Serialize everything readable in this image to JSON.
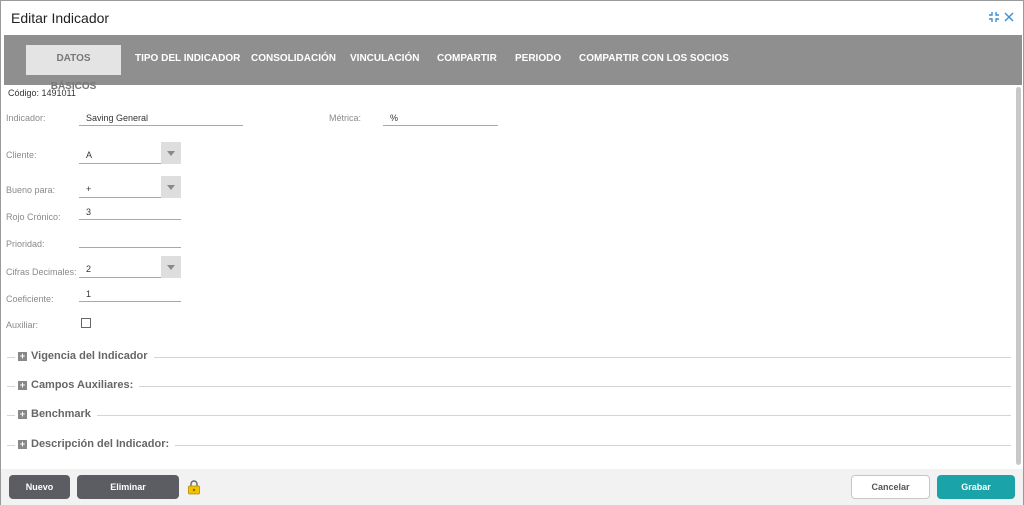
{
  "window": {
    "title": "Editar Indicador",
    "icons": [
      "collapse-icon",
      "close-icon"
    ]
  },
  "tabs": [
    {
      "label": "DATOS BÁSICOS",
      "active": true
    },
    {
      "label": "TIPO DEL INDICADOR",
      "active": false
    },
    {
      "label": "CONSOLIDACIÓN",
      "active": false
    },
    {
      "label": "VINCULACIÓN",
      "active": false
    },
    {
      "label": "COMPARTIR",
      "active": false
    },
    {
      "label": "PERIODO",
      "active": false
    },
    {
      "label": "COMPARTIR CON LOS SOCIOS",
      "active": false
    }
  ],
  "form": {
    "code": "Código: 1491011",
    "indicador": {
      "label": "Indicador:",
      "value": "Saving General"
    },
    "metrica": {
      "label": "Métrica:",
      "value": "%"
    },
    "cliente": {
      "label": "Cliente:",
      "value": "A"
    },
    "bueno_para": {
      "label": "Bueno para:",
      "value": "+"
    },
    "rojo_cronico": {
      "label": "Rojo Crónico:",
      "value": "3"
    },
    "prioridad": {
      "label": "Prioridad:",
      "value": ""
    },
    "cifras_decimales": {
      "label": "Cifras Decimales:",
      "value": "2"
    },
    "coeficiente": {
      "label": "Coeficiente:",
      "value": "1"
    },
    "auxiliar": {
      "label": "Auxiliar:",
      "checked": false
    }
  },
  "sections": [
    "Vigencia del Indicador",
    "Campos Auxiliares:",
    "Benchmark",
    "Descripción del Indicador:"
  ],
  "footer": {
    "nuevo": "Nuevo",
    "eliminar": "Eliminar",
    "cancelar": "Cancelar",
    "grabar": "Grabar",
    "lock_icon": "lock-icon"
  },
  "colors": {
    "tabbar": "#8f8f8f",
    "primary": "#1aa3a8",
    "dark_button": "#5c5d63"
  }
}
